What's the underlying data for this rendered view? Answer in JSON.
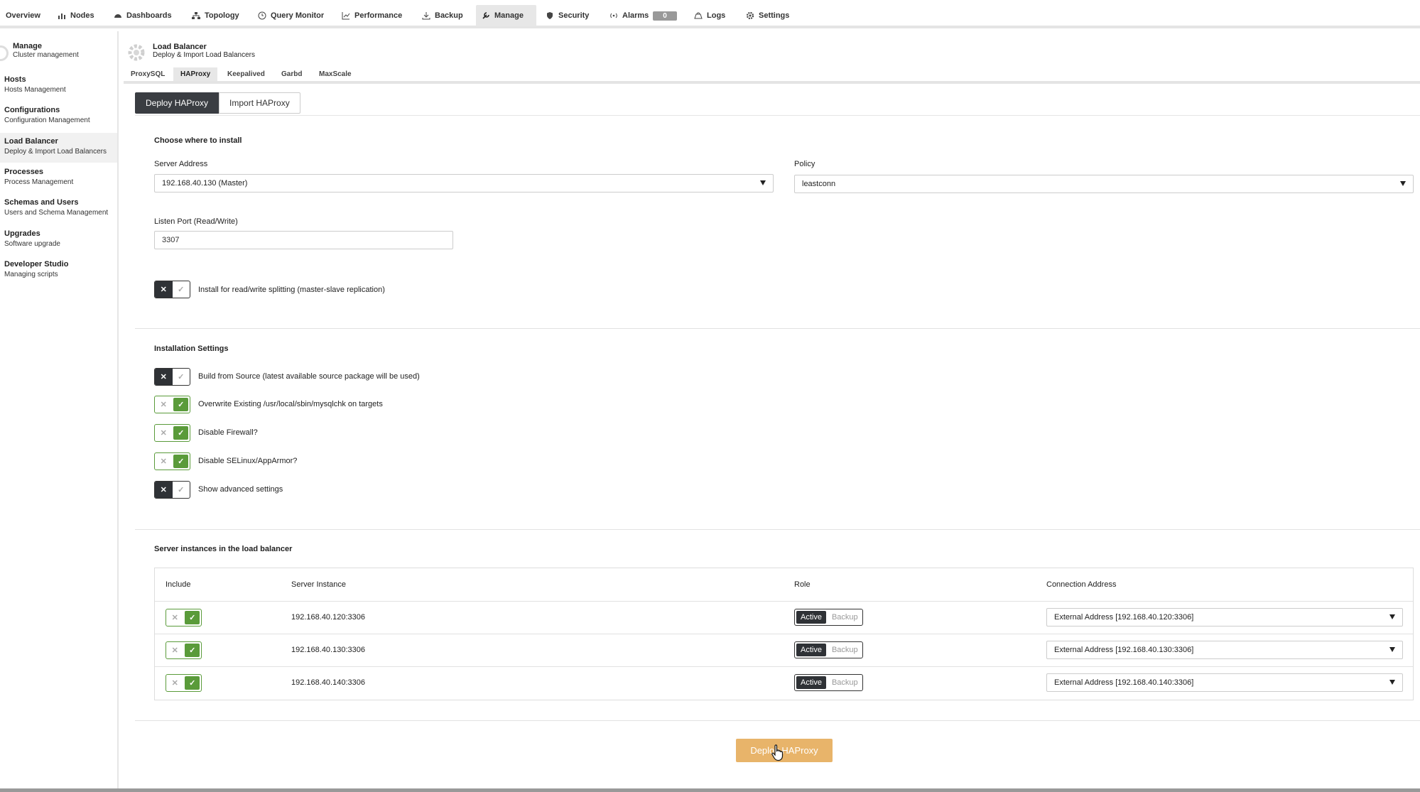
{
  "topnav": {
    "items": [
      {
        "label": "Overview",
        "icon": ""
      },
      {
        "label": "Nodes",
        "icon": "nodes-icon"
      },
      {
        "label": "Dashboards",
        "icon": "dashboard-icon"
      },
      {
        "label": "Topology",
        "icon": "topology-icon"
      },
      {
        "label": "Query Monitor",
        "icon": "clock-icon"
      },
      {
        "label": "Performance",
        "icon": "chart-icon"
      },
      {
        "label": "Backup",
        "icon": "download-icon"
      },
      {
        "label": "Manage",
        "icon": "wrench-icon"
      },
      {
        "label": "Security",
        "icon": "shield-icon"
      },
      {
        "label": "Alarms",
        "icon": "signal-icon"
      },
      {
        "label": "Logs",
        "icon": "logs-icon"
      },
      {
        "label": "Settings",
        "icon": "gear-icon"
      }
    ],
    "alarms_count": "0",
    "active": "Manage"
  },
  "sidebar": {
    "header_title": "Manage",
    "header_sub": "Cluster management",
    "items": [
      {
        "title": "Hosts",
        "sub": "Hosts Management"
      },
      {
        "title": "Configurations",
        "sub": "Configuration Management"
      },
      {
        "title": "Load Balancer",
        "sub": "Deploy & Import Load Balancers"
      },
      {
        "title": "Processes",
        "sub": "Process Management"
      },
      {
        "title": "Schemas and Users",
        "sub": "Users and Schema Management"
      },
      {
        "title": "Upgrades",
        "sub": "Software upgrade"
      },
      {
        "title": "Developer Studio",
        "sub": "Managing scripts"
      }
    ]
  },
  "page": {
    "title": "Load Balancer",
    "subtitle": "Deploy & Import Load Balancers",
    "subtabs": [
      "ProxySQL",
      "HAProxy",
      "Keepalived",
      "Garbd",
      "MaxScale"
    ],
    "deploy_tab": "Deploy HAProxy",
    "import_tab": "Import HAProxy"
  },
  "install": {
    "section_title": "Choose where to install",
    "server_address_label": "Server Address",
    "server_address_value": "192.168.40.130 (Master)",
    "policy_label": "Policy",
    "policy_value": "leastconn",
    "listen_port_label": "Listen Port (Read/Write)",
    "listen_port_value": "3307",
    "rw_split_label": "Install for read/write splitting (master-slave replication)",
    "rw_split_on": false
  },
  "settings": {
    "section_title": "Installation Settings",
    "options": [
      {
        "label": "Build from Source (latest available source package will be used)",
        "on": false
      },
      {
        "label": "Overwrite Existing /usr/local/sbin/mysqlchk on targets",
        "on": true
      },
      {
        "label": "Disable Firewall?",
        "on": true
      },
      {
        "label": "Disable SELinux/AppArmor?",
        "on": true
      },
      {
        "label": "Show advanced settings",
        "on": false
      }
    ]
  },
  "instances": {
    "section_title": "Server instances in the load balancer",
    "headers": {
      "include": "Include",
      "server": "Server Instance",
      "role": "Role",
      "connection": "Connection Address"
    },
    "role_active": "Active",
    "role_backup": "Backup",
    "rows": [
      {
        "server": "192.168.40.120:3306",
        "connection": "External Address [192.168.40.120:3306]",
        "included": true
      },
      {
        "server": "192.168.40.130:3306",
        "connection": "External Address [192.168.40.130:3306]",
        "included": true
      },
      {
        "server": "192.168.40.140:3306",
        "connection": "External Address [192.168.40.140:3306]",
        "included": true
      }
    ]
  },
  "deploy_button": "Deploy HAProxy",
  "colors": {
    "accent_green": "#5a9b3a",
    "deploy_orange": "#e8b46a",
    "dark": "#2f3236"
  }
}
